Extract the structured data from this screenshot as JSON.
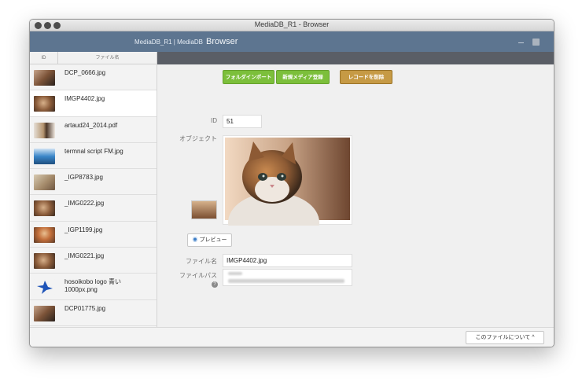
{
  "window": {
    "title": "MediaDB_R1 - Browser"
  },
  "header": {
    "brand": "MediaDB_R1 | MediaDB",
    "brand_big": "Browser"
  },
  "columns": {
    "id": "ID",
    "filename": "ファイル名"
  },
  "files": [
    {
      "name": "DCP_0666.jpg",
      "thumb": "photo"
    },
    {
      "name": "IMGP4402.jpg",
      "thumb": "cat",
      "selected": true
    },
    {
      "name": "artaud24_2014.pdf",
      "thumb": "portrait"
    },
    {
      "name": "termnal script FM.jpg",
      "thumb": "screen"
    },
    {
      "name": "_IGP8783.jpg",
      "thumb": "room"
    },
    {
      "name": "_IMG0222.jpg",
      "thumb": "cat"
    },
    {
      "name": "_IGP1199.jpg",
      "thumb": "cat2"
    },
    {
      "name": "_IMG0221.jpg",
      "thumb": "cat"
    },
    {
      "name": "hosoikobo logo 青い 1000px.png",
      "thumb": "logo"
    },
    {
      "name": "DCP01775.jpg",
      "thumb": "photo"
    }
  ],
  "actions": {
    "folder_import": "フォルダインポート",
    "new_media": "新規メディア登録",
    "delete_record": "レコードを削除"
  },
  "detail": {
    "id_label": "ID",
    "id_value": "51",
    "object_label": "オブジェクト",
    "preview_label": "プレビュー",
    "filename_label": "ファイル名",
    "filename_value": "IMGP4402.jpg",
    "filepath_label": "ファイルパス"
  },
  "footer": {
    "about_button": "このファイルについて ^"
  },
  "colors": {
    "header": "#5d7590",
    "green": "#7cbf3b",
    "gold": "#c69a45"
  }
}
